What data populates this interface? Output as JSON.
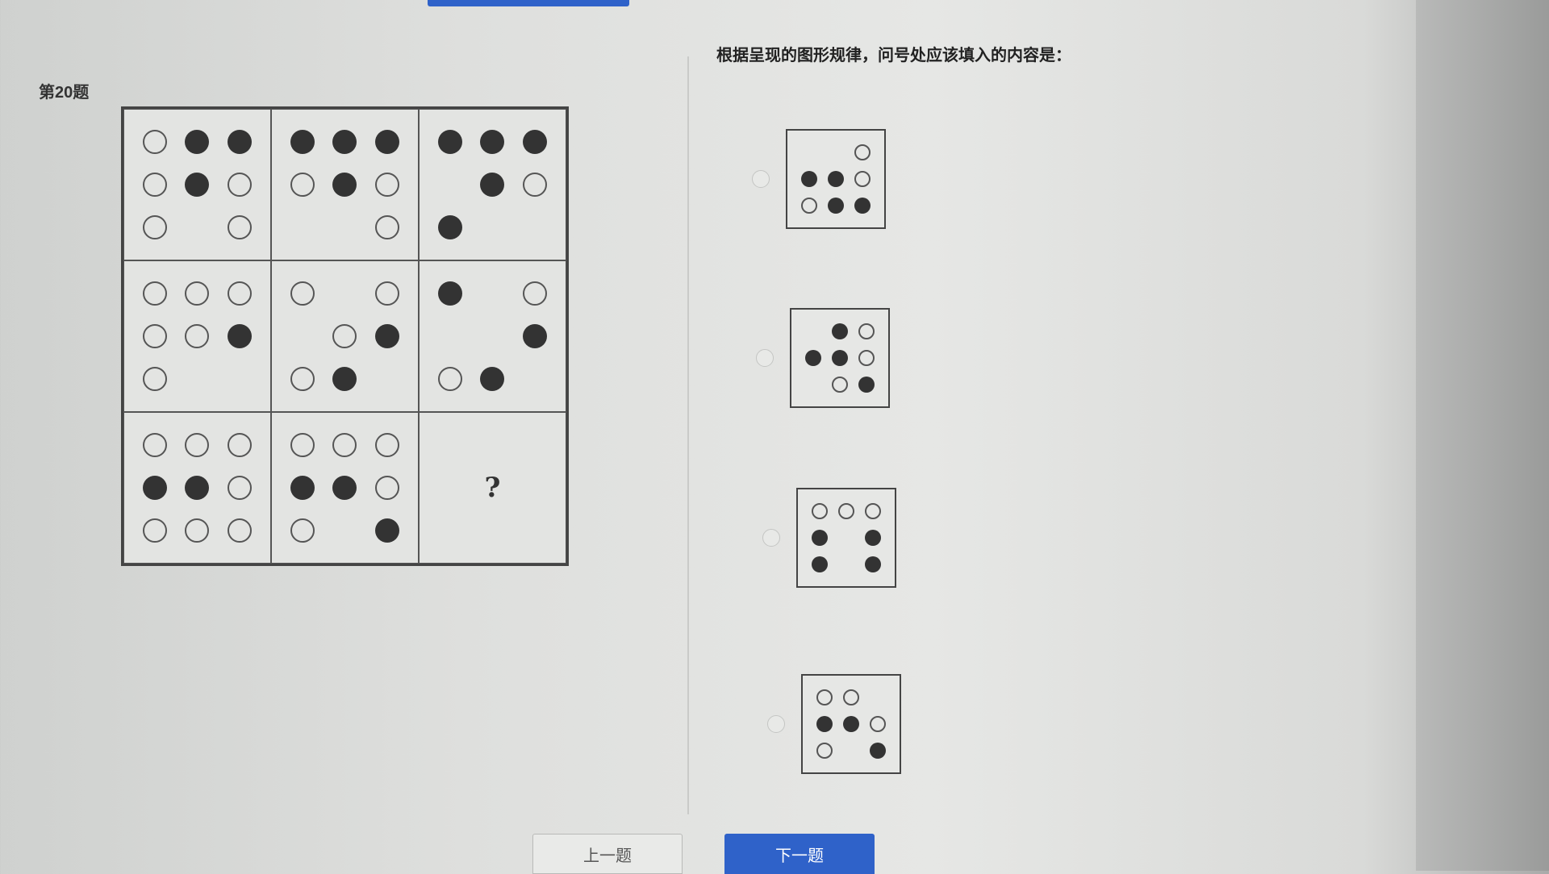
{
  "question": {
    "number_label": "第20题",
    "prompt": "根据呈现的图形规律，问号处应该填入的内容是："
  },
  "matrix": {
    "question_mark": "?",
    "cells": [
      [
        [
          "w",
          "b",
          "b"
        ],
        [
          "w",
          "b",
          "w"
        ],
        [
          "w",
          "",
          "w"
        ]
      ],
      [
        [
          "b",
          "b",
          "b"
        ],
        [
          "w",
          "b",
          "w"
        ],
        [
          "",
          "",
          "w"
        ]
      ],
      [
        [
          "b",
          "b",
          "b"
        ],
        [
          "",
          "b",
          "w"
        ],
        [
          "b",
          "",
          ""
        ]
      ],
      [
        [
          "w",
          "w",
          "w"
        ],
        [
          "w",
          "w",
          "b"
        ],
        [
          "w",
          "",
          ""
        ]
      ],
      [
        [
          "w",
          "",
          "w"
        ],
        [
          "",
          "w",
          "b"
        ],
        [
          "w",
          "b",
          ""
        ]
      ],
      [
        [
          "b",
          "",
          "w"
        ],
        [
          "",
          "",
          "b"
        ],
        [
          "w",
          "b",
          ""
        ]
      ],
      [
        [
          "w",
          "w",
          "w"
        ],
        [
          "b",
          "b",
          "w"
        ],
        [
          "w",
          "w",
          "w"
        ]
      ],
      [
        [
          "w",
          "w",
          "w"
        ],
        [
          "b",
          "b",
          "w"
        ],
        [
          "w",
          "",
          "b"
        ]
      ],
      null
    ]
  },
  "options": [
    {
      "grid": [
        [
          "",
          "",
          "w"
        ],
        [
          "b",
          "b",
          "w"
        ],
        [
          "w",
          "b",
          "b"
        ]
      ]
    },
    {
      "grid": [
        [
          "",
          "b",
          "w"
        ],
        [
          "b",
          "b",
          "w"
        ],
        [
          "",
          "w",
          "b"
        ]
      ]
    },
    {
      "grid": [
        [
          "w",
          "w",
          "w"
        ],
        [
          "b",
          "",
          "b"
        ],
        [
          "b",
          "",
          "b"
        ]
      ]
    },
    {
      "grid": [
        [
          "w",
          "w",
          ""
        ],
        [
          "b",
          "b",
          "w"
        ],
        [
          "w",
          "",
          "b"
        ]
      ]
    }
  ],
  "nav": {
    "prev_label": "上一题",
    "next_label": "下一题"
  }
}
